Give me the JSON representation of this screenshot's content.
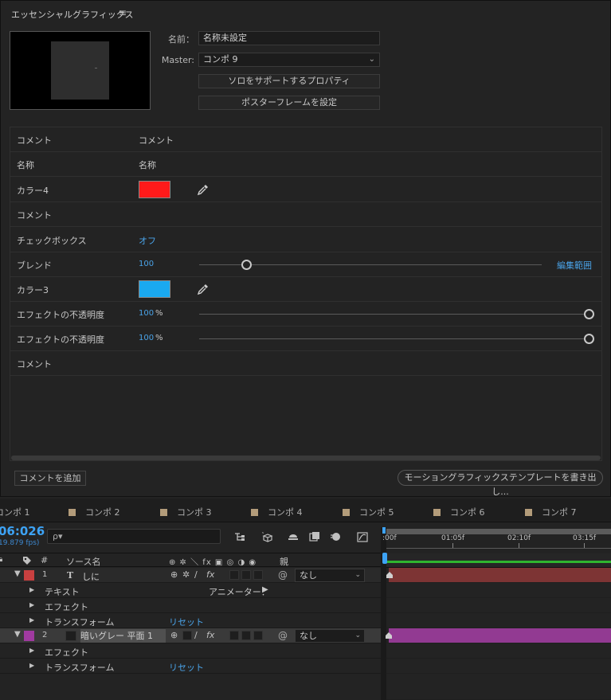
{
  "panel": {
    "title": "エッセンシャルグラフィックス",
    "menu_icon": "≡",
    "name_label": "名前：",
    "name_value": "名称未設定",
    "master_label": "Master:",
    "master_value": "コンポ 9",
    "solo_button": "ソロをサポートするプロパティ",
    "poster_button": "ポスターフレームを設定"
  },
  "properties": [
    {
      "label": "コメント",
      "value": "コメント"
    },
    {
      "label": "名称",
      "value": "名称"
    },
    {
      "label": "カラー4",
      "color": "#ff1a1a"
    },
    {
      "label": "コメント",
      "value": ""
    },
    {
      "label": "チェックボックス",
      "value": "オフ"
    },
    {
      "label": "ブレンド",
      "value": "100",
      "range_link": "編集範囲",
      "slider_fraction": 0.14
    },
    {
      "label": "カラー3",
      "color": "#1aa9f0"
    },
    {
      "label": "エフェクトの不透明度",
      "value": "100",
      "unit": "%",
      "slider_fraction": 1.0
    },
    {
      "label": "エフェクトの不透明度",
      "value": "100",
      "unit": "%",
      "slider_fraction": 1.0
    },
    {
      "label": "コメント",
      "value": ""
    }
  ],
  "footer": {
    "add_comment": "コメントを追加",
    "export": "モーショングラフィックステンプレートを書き出し..."
  },
  "timeline": {
    "tabs": [
      "コンポ 1",
      "コンポ 2",
      "コンポ 3",
      "コンポ 4",
      "コンポ 5",
      "コンポ 6",
      "コンポ 7"
    ],
    "timecode": "06:026",
    "fps": "19.879 fps)",
    "search_icon": "ρ▾",
    "columns": {
      "hash": "#",
      "source": "ソース名",
      "parent": "親"
    },
    "switch_header": "⊕ ✲ ＼ fx ▣ ◎ ◑ ◉",
    "ruler_ticks": [
      ":00f",
      "01:05f",
      "02:10f",
      "03:15f"
    ],
    "layers": [
      {
        "num": "1",
        "type_icon": "T",
        "name": "しに",
        "label_color": "#c94040",
        "parent": "なし",
        "bar_color": "#7d3434",
        "children": [
          {
            "name": "テキスト",
            "extra": "アニメーター：",
            "extra_icon": "▶"
          },
          {
            "name": "エフェクト"
          },
          {
            "name": "トランスフォーム",
            "reset": "リセット"
          }
        ]
      },
      {
        "num": "2",
        "name": "暗いグレー 平面 1",
        "label_color": "#a03aa0",
        "parent": "なし",
        "bar_color": "#923a92",
        "children": [
          {
            "name": "エフェクト"
          },
          {
            "name": "トランスフォーム",
            "reset": "リセット"
          }
        ]
      }
    ]
  }
}
